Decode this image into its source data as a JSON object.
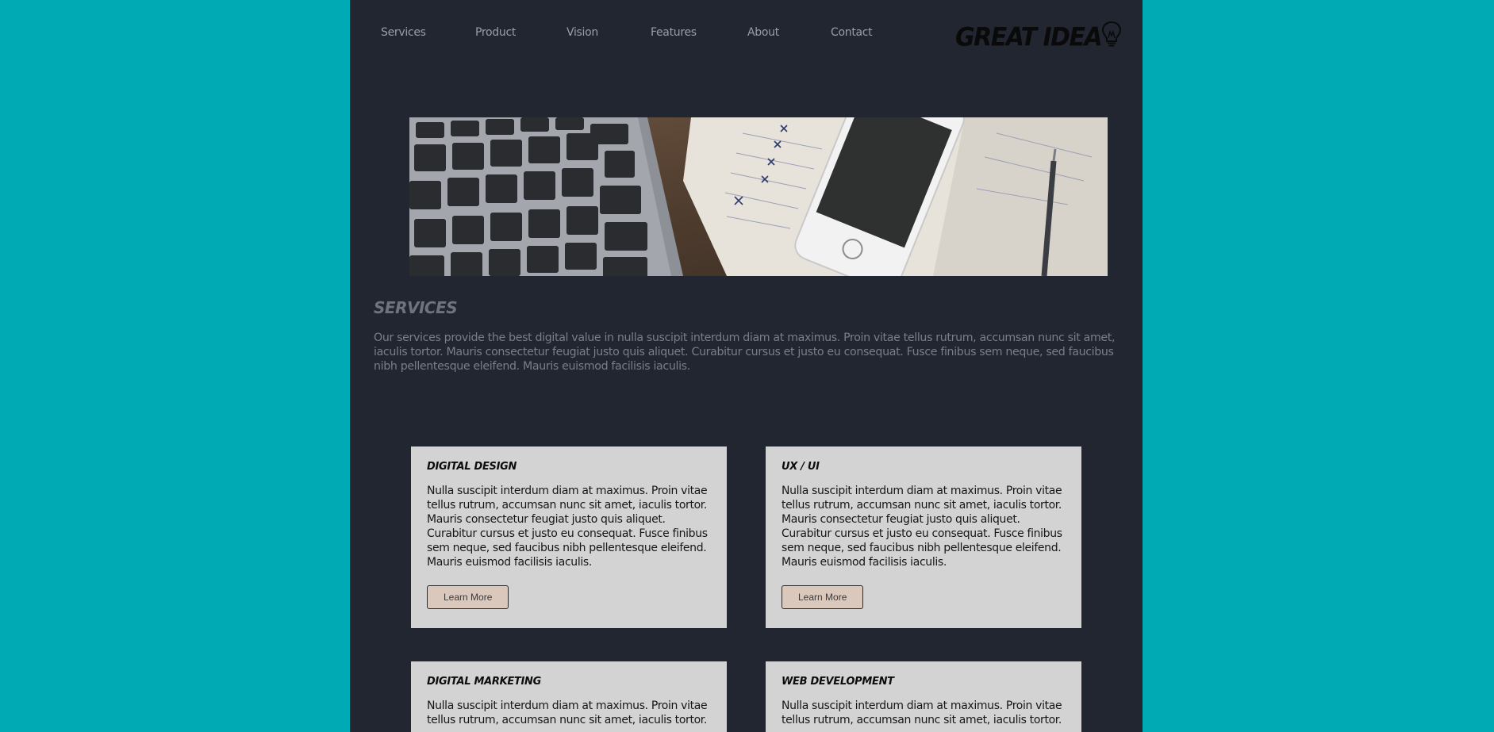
{
  "nav": {
    "items": [
      "Services",
      "Product",
      "Vision",
      "Features",
      "About",
      "Contact"
    ]
  },
  "logo": {
    "text": "GREAT IDEA",
    "icon": "lightbulb-icon"
  },
  "hero": {
    "image": "laptop-phone-notebook-photo"
  },
  "services": {
    "title": "SERVICES",
    "description": "Our services provide the best digital value in nulla suscipit interdum diam at maximus. Proin vitae tellus rutrum, accumsan nunc sit amet, iaculis tortor. Mauris consectetur feugiat justo quis aliquet. Curabitur cursus et justo eu consequat. Fusce finibus sem neque, sed faucibus nibh pellentesque eleifend. Mauris euismod facilisis iaculis."
  },
  "cards": [
    {
      "title": "DIGITAL DESIGN",
      "body": "Nulla suscipit interdum diam at maximus. Proin vitae tellus rutrum, accumsan nunc sit amet, iaculis tortor. Mauris consectetur feugiat justo quis aliquet. Curabitur cursus et justo eu consequat. Fusce finibus sem neque, sed faucibus nibh pellentesque eleifend. Mauris euismod facilisis iaculis.",
      "button": "Learn More"
    },
    {
      "title": "UX / UI",
      "body": "Nulla suscipit interdum diam at maximus. Proin vitae tellus rutrum, accumsan nunc sit amet, iaculis tortor. Mauris consectetur feugiat justo quis aliquet. Curabitur cursus et justo eu consequat. Fusce finibus sem neque, sed faucibus nibh pellentesque eleifend. Mauris euismod facilisis iaculis.",
      "button": "Learn More"
    },
    {
      "title": "DIGITAL MARKETING",
      "body": "Nulla suscipit interdum diam at maximus. Proin vitae tellus rutrum, accumsan nunc sit amet, iaculis tortor.",
      "button": ""
    },
    {
      "title": "WEB DEVELOPMENT",
      "body": "Nulla suscipit interdum diam at maximus. Proin vitae tellus rutrum, accumsan nunc sit amet, iaculis tortor.",
      "button": ""
    }
  ],
  "colors": {
    "background": "#00aab5",
    "page": "#222631",
    "card": "#d3d3d3",
    "button": "#dbc8bd"
  }
}
